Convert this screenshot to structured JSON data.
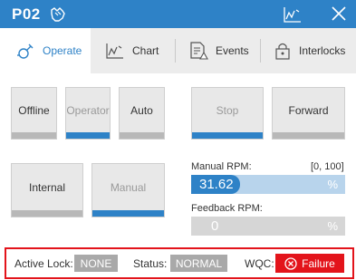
{
  "header": {
    "title": "P02",
    "hand_icon": "hand-icon",
    "trend_icon": "trend-icon",
    "close_icon": "close-icon",
    "accent_color": "#2e82c7"
  },
  "tabs": [
    {
      "label": "Operate",
      "icon": "valve-icon",
      "active": true
    },
    {
      "label": "Chart",
      "icon": "trend-icon",
      "active": false
    },
    {
      "label": "Events",
      "icon": "events-icon",
      "active": false
    },
    {
      "label": "Interlocks",
      "icon": "lock-icon",
      "active": false
    }
  ],
  "mode_buttons": [
    {
      "label": "Offline",
      "selected": false
    },
    {
      "label": "Operator",
      "selected": true
    },
    {
      "label": "Auto",
      "selected": false
    }
  ],
  "command_buttons": [
    {
      "label": "Stop",
      "selected": true
    },
    {
      "label": "Forward",
      "selected": false
    }
  ],
  "source_buttons": [
    {
      "label": "Internal",
      "selected": false
    },
    {
      "label": "Manual",
      "selected": true
    }
  ],
  "manual_rpm": {
    "label": "Manual RPM:",
    "range": "[0, 100]",
    "value": "31.62",
    "unit": "%",
    "fraction": 0.3162
  },
  "feedback_rpm": {
    "label": "Feedback RPM:",
    "value": "0",
    "unit": "%",
    "fraction": 0
  },
  "status_bar": {
    "active_lock_label": "Active Lock:",
    "active_lock_value": "NONE",
    "status_label": "Status:",
    "status_value": "NORMAL",
    "wqc_label": "WQC:",
    "wqc_value": "Failure",
    "failure_color": "#e3141b"
  }
}
